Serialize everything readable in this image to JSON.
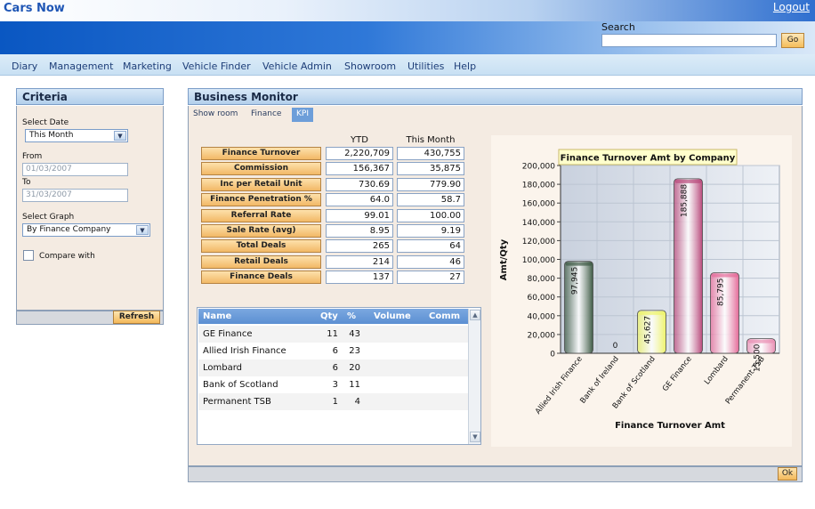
{
  "header": {
    "app_title": "Cars Now",
    "logout": "Logout",
    "search_label": "Search",
    "search_value": "",
    "go_label": "Go"
  },
  "menu": [
    "Diary",
    "Management",
    "Marketing",
    "Vehicle Finder",
    "Vehicle Admin",
    "Showroom",
    "Utilities",
    "Help"
  ],
  "criteria": {
    "title": "Criteria",
    "select_date_label": "Select Date",
    "select_date_value": "This Month",
    "from_label": "From",
    "from_value": "01/03/2007",
    "to_label": "To",
    "to_value": "31/03/2007",
    "select_graph_label": "Select Graph",
    "select_graph_value": "By Finance Company",
    "compare_label": "Compare with",
    "compare_checked": false,
    "refresh_label": "Refresh"
  },
  "monitor": {
    "title": "Business Monitor",
    "tabs": [
      "Show room",
      "Finance",
      "KPI"
    ],
    "active_tab": "KPI",
    "ok_label": "Ok"
  },
  "kpi": {
    "col_ytd": "YTD",
    "col_month": "This Month",
    "rows": [
      {
        "label": "Finance Turnover",
        "ytd": "2,220,709",
        "month": "430,755"
      },
      {
        "label": "Commission",
        "ytd": "156,367",
        "month": "35,875"
      },
      {
        "label": "Inc per Retail Unit",
        "ytd": "730.69",
        "month": "779.90"
      },
      {
        "label": "Finance Penetration %",
        "ytd": "64.0",
        "month": "58.7"
      },
      {
        "label": "Referral Rate",
        "ytd": "99.01",
        "month": "100.00"
      },
      {
        "label": "Sale Rate (avg)",
        "ytd": "8.95",
        "month": "9.19"
      },
      {
        "label": "Total Deals",
        "ytd": "265",
        "month": "64"
      },
      {
        "label": "Retail Deals",
        "ytd": "214",
        "month": "46"
      },
      {
        "label": "Finance Deals",
        "ytd": "137",
        "month": "27"
      }
    ]
  },
  "company_table": {
    "headers": {
      "name": "Name",
      "qty": "Qty",
      "pct": "%",
      "volume": "Volume",
      "comm": "Comm"
    },
    "rows": [
      {
        "name": "GE Finance",
        "qty": "11",
        "pct": "43"
      },
      {
        "name": "Allied Irish Finance",
        "qty": "6",
        "pct": "23"
      },
      {
        "name": "Lombard",
        "qty": "6",
        "pct": "20"
      },
      {
        "name": "Bank of Scotland",
        "qty": "3",
        "pct": "11"
      },
      {
        "name": "Permanent TSB",
        "qty": "1",
        "pct": "4"
      }
    ]
  },
  "chart_data": {
    "type": "bar",
    "title": "Finance Turnover Amt by Company",
    "xlabel": "Finance Turnover Amt",
    "ylabel": "Amt/Qty",
    "categories": [
      "Allied Irish Finance",
      "Bank of Ireland",
      "Bank of Scotland",
      "GE Finance",
      "Lombard",
      "Permanent TSB"
    ],
    "values": [
      97945,
      0,
      45627,
      185888,
      85795,
      15500
    ],
    "value_labels": [
      "97,945",
      "0",
      "45,627",
      "185,888",
      "85,795",
      "15,500"
    ],
    "ylim": [
      0,
      200000
    ],
    "yticks": [
      "0",
      "20,000",
      "40,000",
      "60,000",
      "80,000",
      "100,000",
      "120,000",
      "140,000",
      "160,000",
      "180,000",
      "200,000"
    ],
    "grid": true,
    "colors": {
      "bar_fills": [
        "#3d5a44",
        "#bfe8ff",
        "#eef36a",
        "#b8487a",
        "#e46a98",
        "#e98fb4"
      ],
      "plot_bg": "#dde3ec",
      "title_bg": "#ffffcc"
    }
  }
}
